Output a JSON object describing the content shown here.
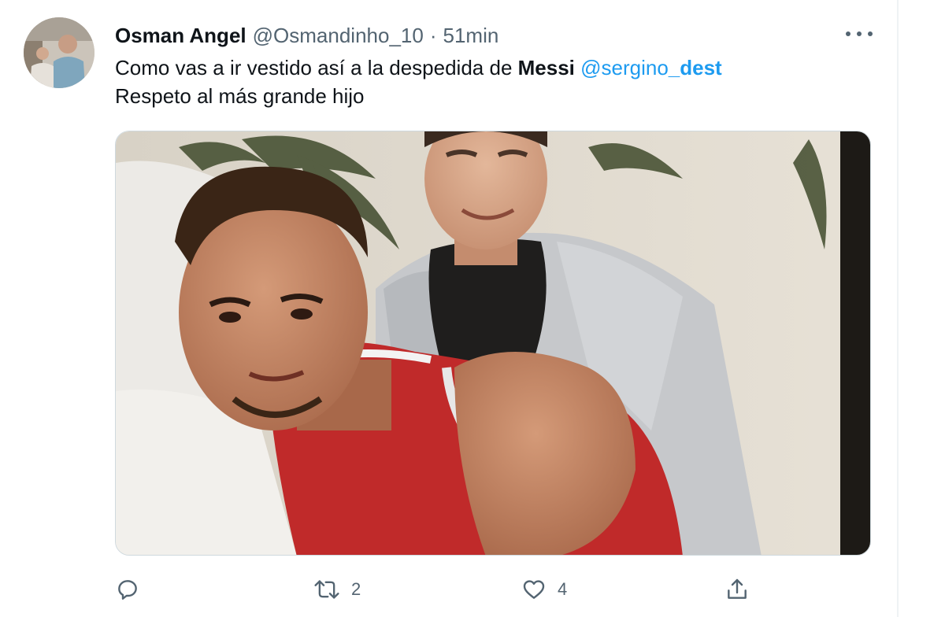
{
  "tweet": {
    "author_name": "Osman Angel",
    "handle": "@Osmandinho_10",
    "separator": "·",
    "time": "51min",
    "text_part1": "Como vas a ir vestido así a la despedida de ",
    "text_bold": "Messi",
    "mention_prefix": "@sergino",
    "mention_suffix": "_dest",
    "text_line2": "Respeto al más grande hijo"
  },
  "actions": {
    "reply_icon": "reply-icon",
    "retweet_icon": "retweet-icon",
    "retweet_count": "2",
    "like_icon": "heart-icon",
    "like_count": "4",
    "share_icon": "share-icon"
  },
  "colors": {
    "accent": "#1d9bf0",
    "secondary_text": "#536471",
    "primary_text": "#0f1419"
  }
}
